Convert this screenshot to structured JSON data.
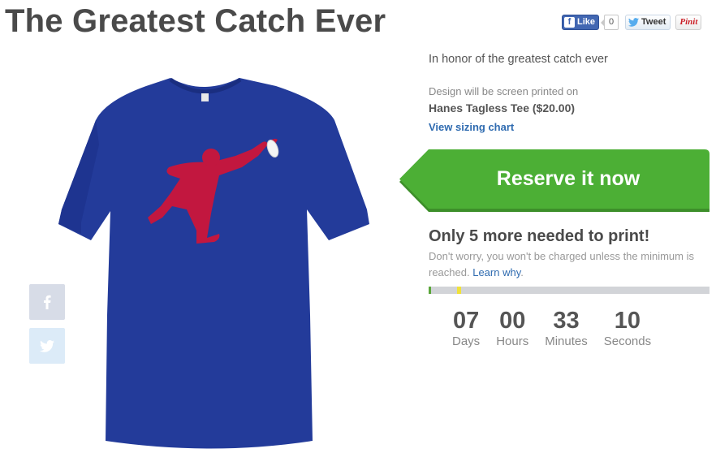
{
  "page": {
    "title": "The Greatest Catch Ever"
  },
  "social": {
    "like_label": "Like",
    "like_count": "0",
    "tweet_label": "Tweet",
    "pin_label": "Pinit"
  },
  "product": {
    "description": "In honor of the greatest catch ever",
    "print_note": "Design will be screen printed on",
    "name": "Hanes Tagless Tee ($20.00)",
    "sizing_link": "View sizing chart",
    "shirt_color": "#233b9a",
    "figure_color": "#c2173f"
  },
  "reserve": {
    "label": "Reserve it now",
    "color": "#4caf35"
  },
  "campaign": {
    "needed_title": "Only 5 more needed to print!",
    "worry_text": "Don't worry, you won't be charged unless the minimum is reached.",
    "learn_why": "Learn why",
    "period": ".",
    "progress_fraction": 0.01,
    "target_marker_fraction": 0.1
  },
  "countdown": [
    {
      "value": "07",
      "label": "Days"
    },
    {
      "value": "00",
      "label": "Hours"
    },
    {
      "value": "33",
      "label": "Minutes"
    },
    {
      "value": "10",
      "label": "Seconds"
    }
  ],
  "icons": {
    "facebook": "facebook-icon",
    "twitter": "twitter-icon"
  }
}
